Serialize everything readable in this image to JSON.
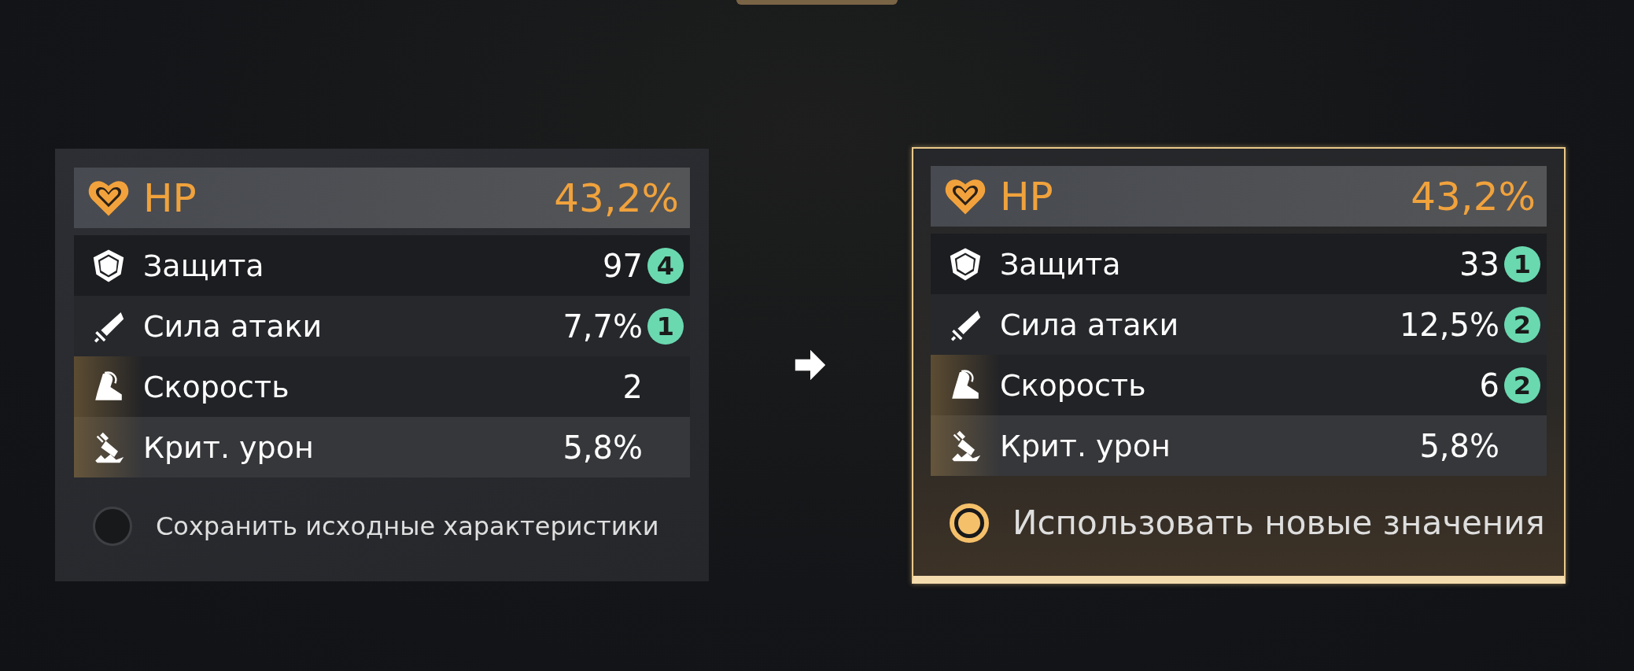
{
  "panels": [
    {
      "selected": false,
      "option": "Сохранить исходные характеристики",
      "stats": [
        {
          "kind": "hp",
          "label": "HP",
          "value": "43,2%"
        },
        {
          "kind": "defense",
          "label": "Защита",
          "value": "97",
          "bonus": "4"
        },
        {
          "kind": "attack",
          "label": "Сила атаки",
          "value": "7,7%",
          "bonus": "1"
        },
        {
          "kind": "speed",
          "label": "Скорость",
          "value": "2"
        },
        {
          "kind": "crit",
          "label": "Крит. урон",
          "value": "5,8%"
        }
      ]
    },
    {
      "selected": true,
      "option": "Использовать новые значения",
      "stats": [
        {
          "kind": "hp",
          "label": "HP",
          "value": "43,2%"
        },
        {
          "kind": "defense",
          "label": "Защита",
          "value": "33",
          "bonus": "1"
        },
        {
          "kind": "attack",
          "label": "Сила атаки",
          "value": "12,5%",
          "bonus": "2"
        },
        {
          "kind": "speed",
          "label": "Скорость",
          "value": "6",
          "bonus": "2"
        },
        {
          "kind": "crit",
          "label": "Крит. урон",
          "value": "5,8%"
        }
      ]
    }
  ]
}
